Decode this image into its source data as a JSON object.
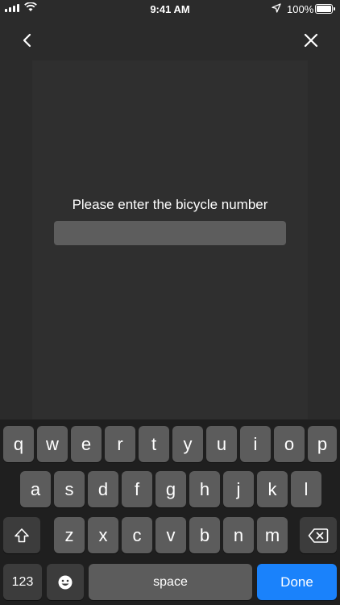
{
  "status_bar": {
    "time": "9:41 AM",
    "battery": "100%"
  },
  "prompt": "Please enter the bicycle number",
  "input": {
    "value": "",
    "placeholder": ""
  },
  "keyboard": {
    "row1": [
      "q",
      "w",
      "e",
      "r",
      "t",
      "y",
      "u",
      "i",
      "o",
      "p"
    ],
    "row2": [
      "a",
      "s",
      "d",
      "f",
      "g",
      "h",
      "j",
      "k",
      "l"
    ],
    "row3": [
      "z",
      "x",
      "c",
      "v",
      "b",
      "n",
      "m"
    ],
    "numbers_label": "123",
    "space_label": "space",
    "done_label": "Done"
  },
  "icons": {
    "signal": "signal-icon",
    "wifi": "wifi-icon",
    "location": "location-icon",
    "battery": "battery-icon",
    "back": "chevron-left-icon",
    "close": "close-icon",
    "shift": "shift-icon",
    "delete": "backspace-icon",
    "emoji": "emoji-icon"
  },
  "colors": {
    "background": "#2b2b2b",
    "keyboard": "#1f1f1f",
    "key": "#5c5c5c",
    "done": "#1a82fb"
  }
}
